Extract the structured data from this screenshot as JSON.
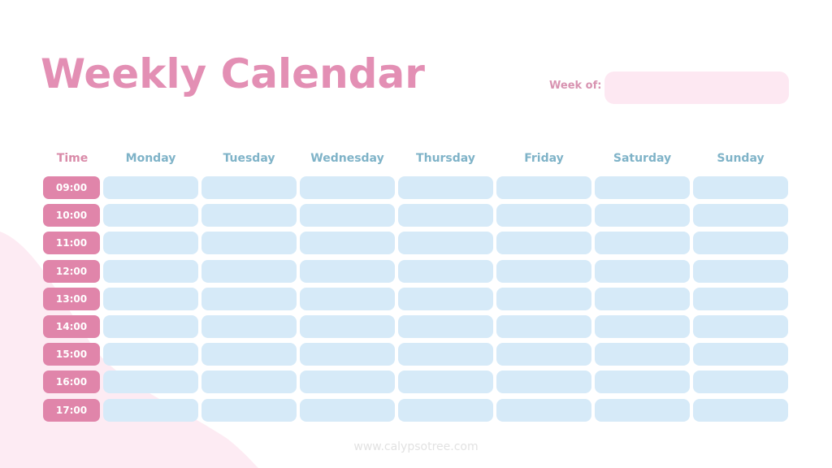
{
  "title": "Weekly Calendar",
  "week_of": {
    "label": "Week of:",
    "value": ""
  },
  "table": {
    "time_header": "Time",
    "days": [
      "Monday",
      "Tuesday",
      "Wednesday",
      "Thursday",
      "Friday",
      "Saturday",
      "Sunday"
    ],
    "times": [
      "09:00",
      "10:00",
      "11:00",
      "12:00",
      "13:00",
      "14:00",
      "15:00",
      "16:00",
      "17:00"
    ]
  },
  "footer": "www.calypsotree.com",
  "colors": {
    "title": "#e38fb4",
    "time_badge": "#e085aa",
    "cell": "#d6eaf8",
    "day_header": "#7fb3c8",
    "week_field": "#fde8f2",
    "background_blob": "#fdebf3"
  }
}
